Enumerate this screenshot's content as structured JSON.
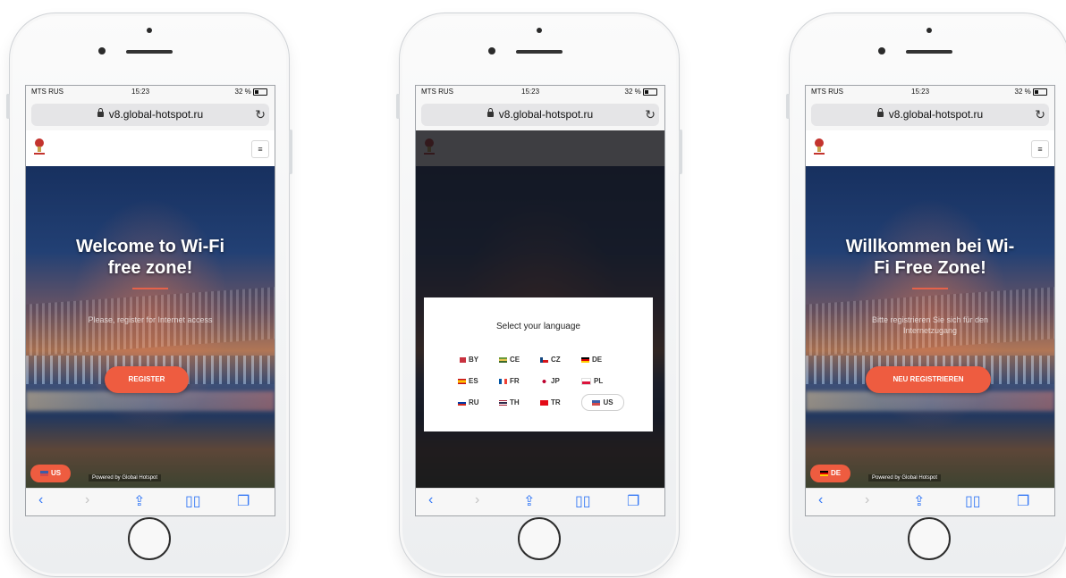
{
  "phones": [
    {
      "status": {
        "carrier": "MTS RUS",
        "time": "15:23",
        "battery": "32 %"
      },
      "url": "v8.global-hotspot.ru",
      "headline": "Welcome to Wi-Fi free zone!",
      "subtext": "Please, register for Internet access",
      "register_label": "REGISTER",
      "language_pill": "US",
      "powered_by": "Powered by  Global Hotspot"
    },
    {
      "status": {
        "carrier": "MTS RUS",
        "time": "15:23",
        "battery": "32 %"
      },
      "url": "v8.global-hotspot.ru",
      "modal_title": "Select your language",
      "languages": [
        "BY",
        "CE",
        "CZ",
        "DE",
        "ES",
        "FR",
        "JP",
        "PL",
        "RU",
        "TH",
        "TR",
        "US"
      ],
      "selected_language": "US"
    },
    {
      "status": {
        "carrier": "MTS RUS",
        "time": "15:23",
        "battery": "32 %"
      },
      "url": "v8.global-hotspot.ru",
      "headline": "Willkommen bei Wi-Fi Free Zone!",
      "subtext": "Bitte registrieren Sie sich für den Internetzugang",
      "register_label": "NEU REGISTRIEREN",
      "language_pill": "DE",
      "powered_by": "Powered by  Global Hotspot"
    }
  ],
  "icons": {
    "back": "chevron-left-icon",
    "forward": "chevron-right-icon",
    "share": "share-icon",
    "bookmarks": "book-icon",
    "tabs": "tabs-icon",
    "reload": "reload-icon",
    "menu": "hamburger-menu-icon"
  },
  "colors": {
    "accent": "#ee5c40",
    "link": "#3478f6"
  }
}
